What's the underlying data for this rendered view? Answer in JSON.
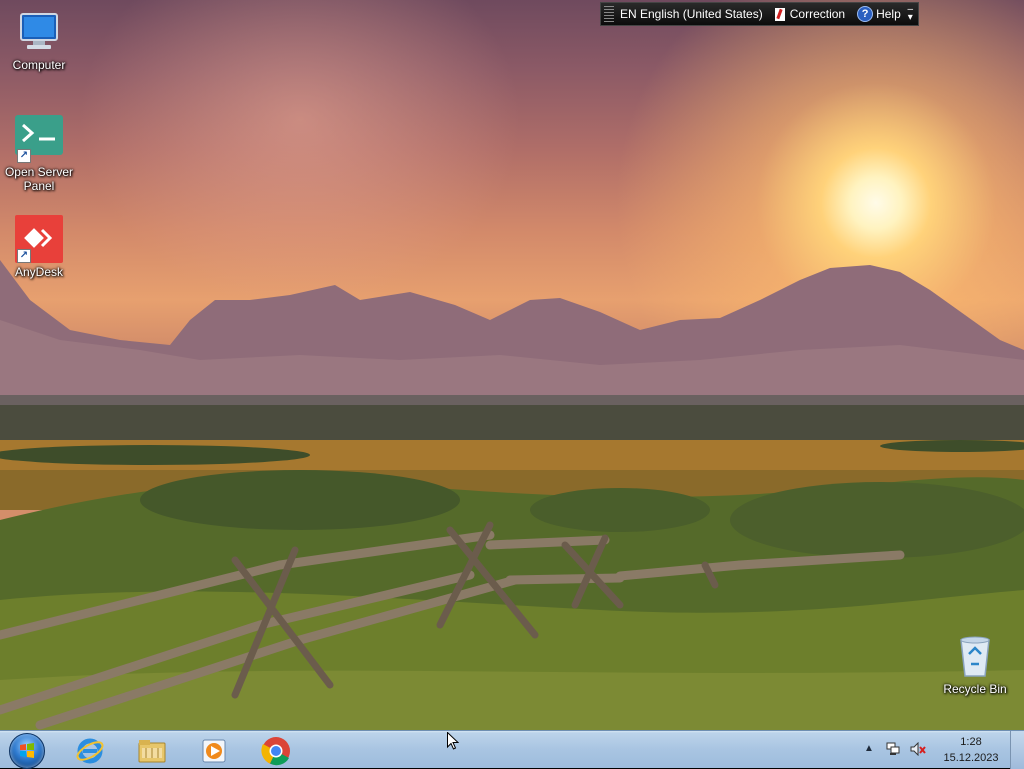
{
  "desktop": {
    "icons": [
      {
        "label": "Computer",
        "icon": "computer-icon"
      },
      {
        "label": "Open Server Panel",
        "icon": "open-server-panel-icon"
      },
      {
        "label": "AnyDesk",
        "icon": "anydesk-icon"
      },
      {
        "label": "Recycle Bin",
        "icon": "recycle-bin-icon"
      }
    ]
  },
  "language_bar": {
    "language_label": "EN English (United States)",
    "correction_label": "Correction",
    "help_label": "Help",
    "help_glyph": "?"
  },
  "taskbar": {
    "pinned": [
      {
        "name": "Internet Explorer",
        "icon": "internet-explorer-icon"
      },
      {
        "name": "Windows Explorer",
        "icon": "file-explorer-icon"
      },
      {
        "name": "Windows Media Player",
        "icon": "media-player-icon"
      },
      {
        "name": "Google Chrome",
        "icon": "chrome-icon"
      }
    ],
    "clock": {
      "time": "1:28",
      "date": "15.12.2023"
    }
  },
  "colors": {
    "taskbar": "#a9c5e2",
    "langbar": "#111111",
    "anydesk_red": "#e8403a",
    "open_server_green": "#3a9f8a"
  }
}
